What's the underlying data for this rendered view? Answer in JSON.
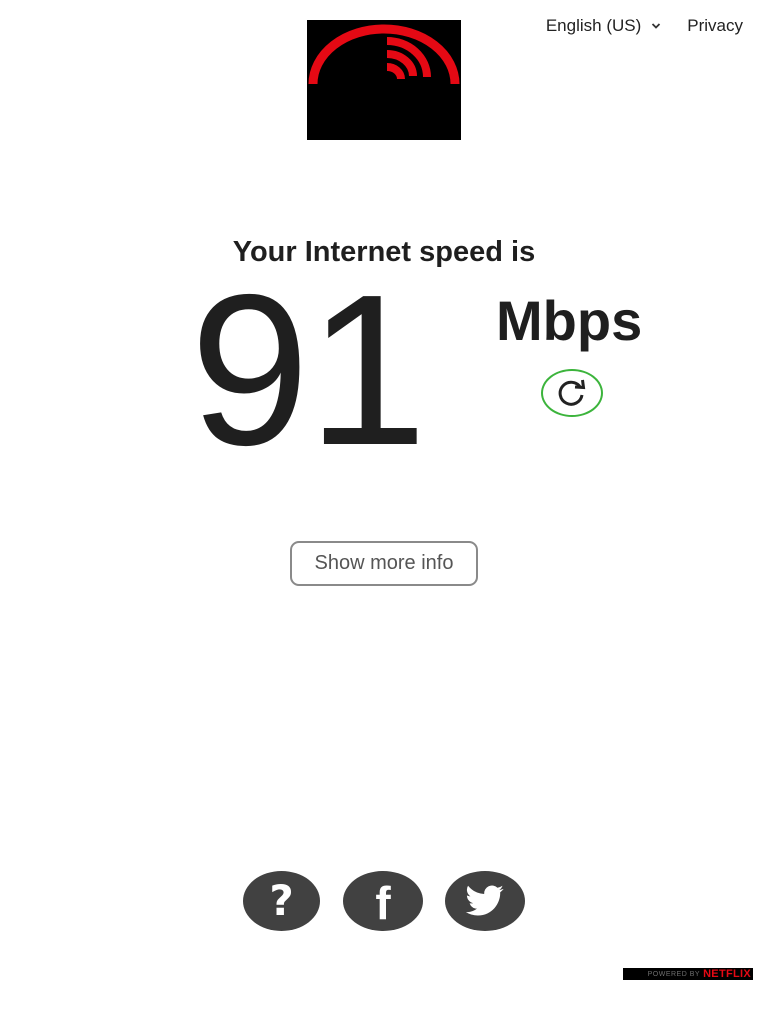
{
  "header": {
    "language_label": "English (US)",
    "privacy_label": "Privacy"
  },
  "result": {
    "headline": "Your Internet speed is",
    "speed_value": "91",
    "speed_units": "Mbps"
  },
  "actions": {
    "show_more_label": "Show more info"
  },
  "social": {
    "help_glyph": "?",
    "facebook_glyph": "f"
  },
  "footer": {
    "powered_by_text": "POWERED BY",
    "powered_by_brand": "NETFLIX"
  },
  "colors": {
    "logo_red": "#e50914",
    "refresh_green": "#3cb43c",
    "social_gray": "#414141",
    "text_dark": "#1f1f1f"
  },
  "icons": {
    "logo": "speed-gauge-logo-icon",
    "language": "chevron-down-icon",
    "refresh": "refresh-icon",
    "help": "question-icon",
    "facebook": "facebook-icon",
    "twitter": "twitter-icon"
  }
}
